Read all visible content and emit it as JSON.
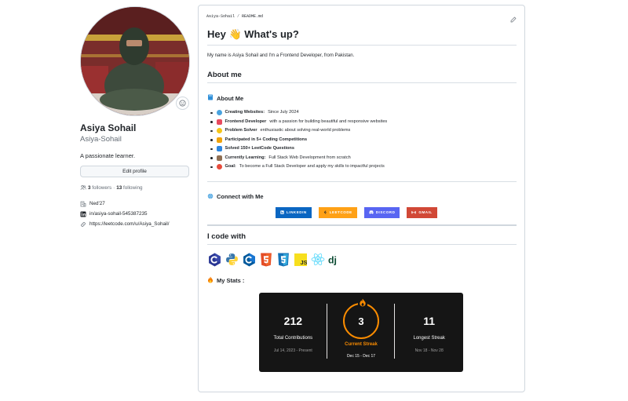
{
  "profile": {
    "full_name": "Asiya Sohail",
    "username": "Asiya-Sohail",
    "bio": "A passionate learner.",
    "edit_label": "Edit profile",
    "followers_count": "3",
    "followers_label": "followers",
    "following_count": "13",
    "following_label": "following",
    "organization": "Ned'27",
    "linkedin": "in/asiya-sohail-545387235",
    "website": "https://leetcode.com/u/Asiya_Sohail/"
  },
  "readme": {
    "breadcrumb_user": "Asiya-Sohail",
    "breadcrumb_file": "README.md",
    "title": "Hey 👋 What's up?",
    "intro": "My name is Asiya Sohail and I'm a Frontend Developer, from Pakistan.",
    "about_heading": "About me",
    "about_sub": "About Me",
    "about_items": [
      {
        "bold": "Creating Websites:",
        "rest": " Since July 2024",
        "color": "#4aa3df"
      },
      {
        "bold": "Frontend Developer",
        "rest": " with a passion for building beautiful and responsive websites",
        "color": "#e84a5f"
      },
      {
        "bold": "Problem Solver",
        "rest": " enthusiastic about solving real-world problems",
        "color": "#f5c518"
      },
      {
        "bold": "Participated in 5+ Coding Competitions",
        "rest": "",
        "color": "#f0a30a"
      },
      {
        "bold": "Solved 150+ LeetCode Questions",
        "rest": "",
        "color": "#2e86de"
      },
      {
        "bold": "Currently Learning:",
        "rest": " Full Stack Web Development from scratch",
        "color": "#8e6e53"
      },
      {
        "bold": "Goal:",
        "rest": " To become a Full Stack Developer and apply my skills to impactful projects",
        "color": "#e74c3c"
      }
    ],
    "connect_heading": "Connect with Me",
    "badges": [
      {
        "label": "LINKEDIN",
        "color": "#0a66c2"
      },
      {
        "label": "LEETCODE",
        "color": "#ffa116"
      },
      {
        "label": "DISCORD",
        "color": "#5865f2"
      },
      {
        "label": "GMAIL",
        "color": "#d14836"
      }
    ],
    "code_heading": "I code with",
    "stats_heading": "My Stats :"
  },
  "stats": {
    "total": "212",
    "total_label": "Total Contributions",
    "total_range": "Jul 14, 2023 - Present",
    "current": "3",
    "current_label": "Current Streak",
    "current_range": "Dec 15 - Dec 17",
    "longest": "11",
    "longest_label": "Longest Streak",
    "longest_range": "Nov 18 - Nov 28"
  },
  "colors": {
    "accent_orange": "#fb8c00",
    "border": "#d0d7de"
  }
}
